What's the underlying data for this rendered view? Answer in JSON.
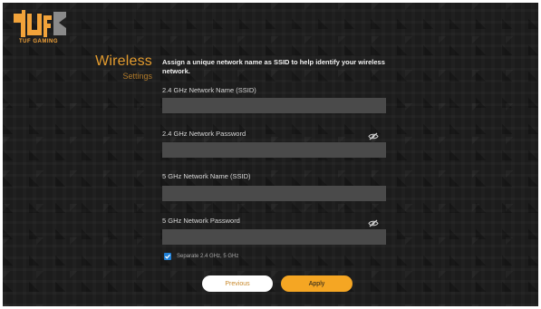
{
  "brand": {
    "logo_text": "TUF GAMING",
    "accent_color": "#e39b2e"
  },
  "section": {
    "title": "Wireless",
    "subtitle": "Settings"
  },
  "intro": {
    "text": "Assign a unique network name as SSID to help identify your wireless network."
  },
  "fields": [
    {
      "label": "2.4 GHz Network Name (SSID)",
      "value": "",
      "placeholder": ""
    },
    {
      "label": "2.4 GHz Network Password",
      "value": "",
      "placeholder": "",
      "icon": "eye-slash-icon"
    },
    {
      "label": "5 GHz Network Name (SSID)",
      "value": "",
      "placeholder": ""
    },
    {
      "label": "5 GHz Network Password",
      "value": "",
      "placeholder": "",
      "icon": "eye-slash-icon"
    }
  ],
  "separate": {
    "label": "Separate 2.4 GHz, 5 GHz",
    "checked": true,
    "color": "#1f7fd6"
  },
  "buttons": {
    "previous": "Previous",
    "apply": "Apply",
    "apply_color": "#f5a623"
  }
}
